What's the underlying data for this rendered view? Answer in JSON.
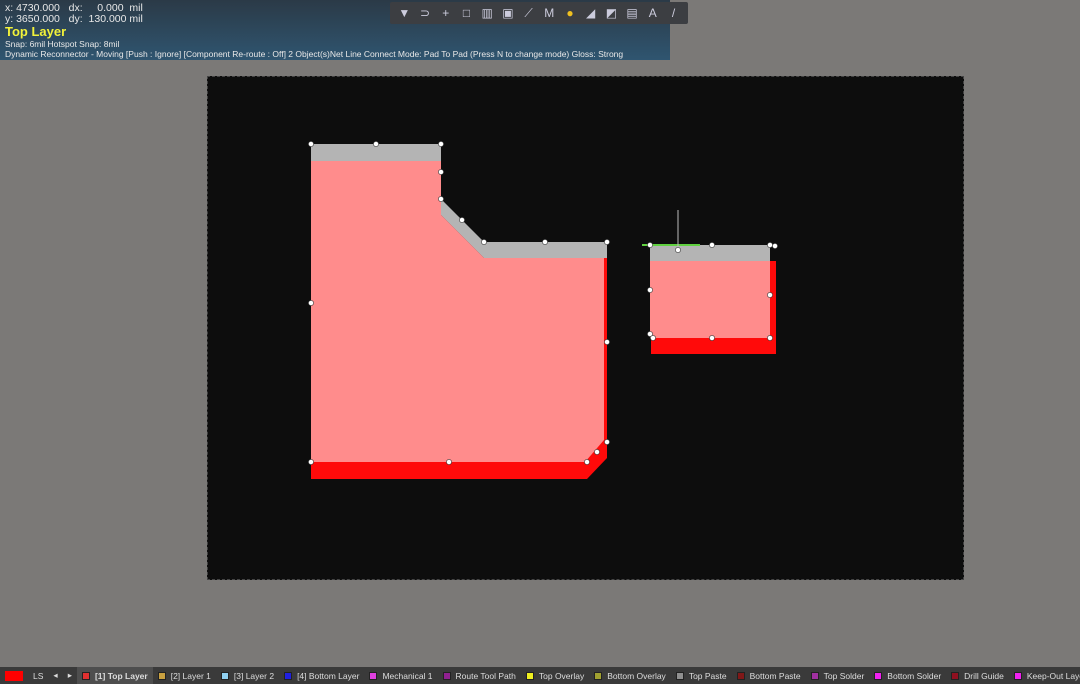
{
  "hud": {
    "x_label": "x:",
    "x": "4730.000",
    "dx_label": "dx:",
    "dx": "0.000",
    "y_label": "y:",
    "y": "3650.000",
    "dy_label": "dy:",
    "dy": "130.000",
    "unit": "mil",
    "layer": "Top Layer",
    "snap": "Snap: 6mil Hotspot Snap: 8mil",
    "status": "Dynamic Reconnector - Moving [Push : Ignore] [Component Re-route : Off] 2 Object(s)Net Line Connect Mode: Pad To Pad (Press N to change mode) Gloss: Strong"
  },
  "toolbar": [
    {
      "icon": "filter-icon",
      "glyph": "▼"
    },
    {
      "icon": "lasso-icon",
      "glyph": "⊃"
    },
    {
      "icon": "crosshair-icon",
      "glyph": "+"
    },
    {
      "icon": "select-rect-icon",
      "glyph": "□"
    },
    {
      "icon": "chart-icon",
      "glyph": "▥"
    },
    {
      "icon": "component-icon",
      "glyph": "▣"
    },
    {
      "icon": "route-icon",
      "glyph": "⟋"
    },
    {
      "icon": "diff-pair-icon",
      "glyph": "M"
    },
    {
      "icon": "pin-icon",
      "glyph": "●"
    },
    {
      "icon": "polygon-icon",
      "glyph": "◢"
    },
    {
      "icon": "region-icon",
      "glyph": "◩"
    },
    {
      "icon": "dimension-icon",
      "glyph": "▤"
    },
    {
      "icon": "text-icon",
      "glyph": "A"
    },
    {
      "icon": "line-icon",
      "glyph": "/"
    }
  ],
  "colors": {
    "copper": "#ff8c8c",
    "edge": "#ff0a0a",
    "gloss": "#b4b4b4",
    "canvas": "#0d0d0d"
  },
  "layerbar": {
    "current_color": "#ff0000",
    "ls": "LS",
    "tabs": [
      {
        "label": "[1] Top Layer",
        "color": "#e03030",
        "active": true
      },
      {
        "label": "[2] Layer 1",
        "color": "#c8a040"
      },
      {
        "label": "[3] Layer 2",
        "color": "#90d0f0"
      },
      {
        "label": "[4] Bottom Layer",
        "color": "#2020e0"
      },
      {
        "label": "Mechanical 1",
        "color": "#e040e0"
      },
      {
        "label": "Route Tool Path",
        "color": "#902090"
      },
      {
        "label": "Top Overlay",
        "color": "#f0f020"
      },
      {
        "label": "Bottom Overlay",
        "color": "#a0a030"
      },
      {
        "label": "Top Paste",
        "color": "#909090"
      },
      {
        "label": "Bottom Paste",
        "color": "#801818"
      },
      {
        "label": "Top Solder",
        "color": "#a030a0"
      },
      {
        "label": "Bottom Solder",
        "color": "#f020f0"
      },
      {
        "label": "Drill Guide",
        "color": "#901020"
      },
      {
        "label": "Keep-Out Layer",
        "color": "#f020f0"
      }
    ]
  }
}
